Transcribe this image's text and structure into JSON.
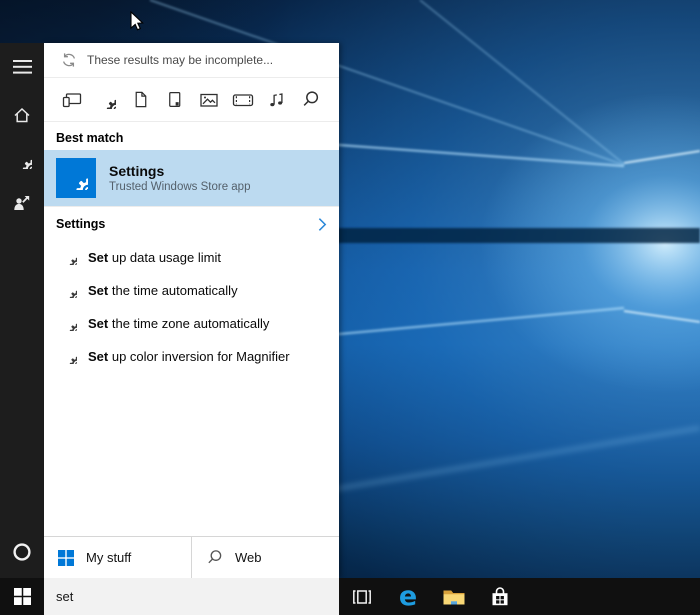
{
  "search_panel": {
    "notice": {
      "text": "These results may be incomplete...",
      "icon": "sync-icon"
    },
    "filter_icons": [
      "apps",
      "settings",
      "documents",
      "folders",
      "photos",
      "videos",
      "music",
      "web"
    ],
    "best_match": {
      "header": "Best match",
      "result": {
        "title": "Settings",
        "subtitle": "Trusted Windows Store app",
        "icon": "settings-gear-tile",
        "tile_color": "#0078d7"
      }
    },
    "category_row": {
      "label": "Settings",
      "chevron": "right"
    },
    "suggestions": [
      {
        "bold": "Set",
        "rest": " up data usage limit"
      },
      {
        "bold": "Set",
        "rest": " the time automatically"
      },
      {
        "bold": "Set",
        "rest": " the time zone automatically"
      },
      {
        "bold": "Set",
        "rest": " up color inversion for Magnifier"
      }
    ],
    "footer": {
      "my_stuff_label": "My stuff",
      "web_label": "Web"
    }
  },
  "sidebar_icons": [
    "hamburger-menu",
    "home",
    "settings",
    "feedback",
    "cortana"
  ],
  "taskbar": {
    "search_value": "set",
    "edge_glyph": "e",
    "icons": [
      "start",
      "task-view",
      "edge",
      "file-explorer",
      "windows-store"
    ]
  },
  "colors": {
    "accent": "#0078d7",
    "highlight_row": "#bcdaf0",
    "chevron": "#2b88d8",
    "sidebar_bg": "#1d1d1d",
    "taskbar_bg": "#101010"
  }
}
